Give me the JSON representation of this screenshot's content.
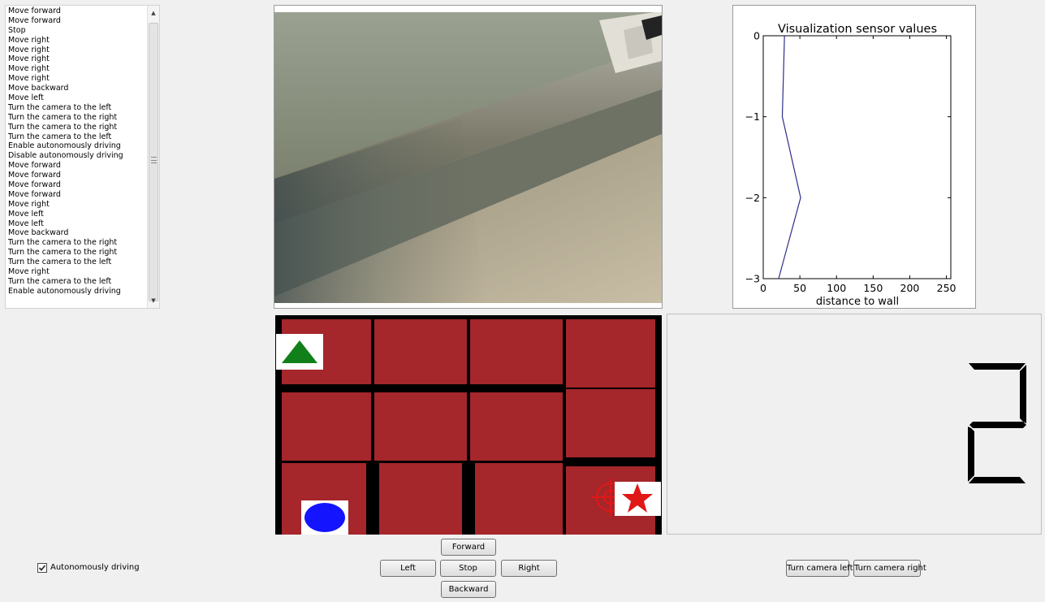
{
  "command_log": {
    "items": [
      "Move forward",
      "Move forward",
      "Stop",
      "Move right",
      "Move right",
      "Move right",
      "Move right",
      "Move right",
      "Move backward",
      "Move left",
      "Turn the camera to the left",
      "Turn the camera to the right",
      "Turn the camera to the right",
      "Turn the camera to the left",
      "Enable autonomously driving",
      "Disable autonomously driving",
      "Move forward",
      "Move forward",
      "Move forward",
      "Move forward",
      "Move right",
      "Move left",
      "Move left",
      "Move backward",
      "Turn the camera to the right",
      "Turn the camera to the right",
      "Turn the camera to the left",
      "Move right",
      "Turn the camera to the left",
      "Enable autonomously driving"
    ]
  },
  "sensor_plot": {
    "chart_data": {
      "type": "line",
      "title": "Visualization sensor values",
      "xlabel": "distance to wall",
      "ylabel": "",
      "xlim": [
        0,
        256
      ],
      "ylim": [
        -3,
        0
      ],
      "xticks": [
        "0",
        "50",
        "100",
        "150",
        "200",
        "250"
      ],
      "yticks": [
        "0",
        "−1",
        "−2",
        "−3"
      ],
      "series": [
        {
          "x": [
            29,
            26,
            51,
            21
          ],
          "y": [
            0,
            -1,
            -2,
            -3
          ],
          "color": "#2e2e8c"
        }
      ],
      "grid": false
    }
  },
  "map": {
    "cell_color": "#a5262b",
    "wall_color": "#000000",
    "markers": [
      {
        "icon": "green-triangle-icon",
        "color": "#11801a"
      },
      {
        "icon": "blue-circle-icon",
        "color": "#1414ff"
      },
      {
        "icon": "red-crosshair-icon",
        "color": "#e01818"
      },
      {
        "icon": "red-star-icon",
        "color": "#e01818"
      }
    ]
  },
  "digit_display": {
    "value": "2"
  },
  "controls": {
    "forward": "Forward",
    "left": "Left",
    "stop": "Stop",
    "right": "Right",
    "backward": "Backward",
    "turn_camera_left": "Turn camera left",
    "turn_camera_right": "Turn camera right"
  },
  "autonomous": {
    "label": "Autonomously driving",
    "checked": true
  }
}
